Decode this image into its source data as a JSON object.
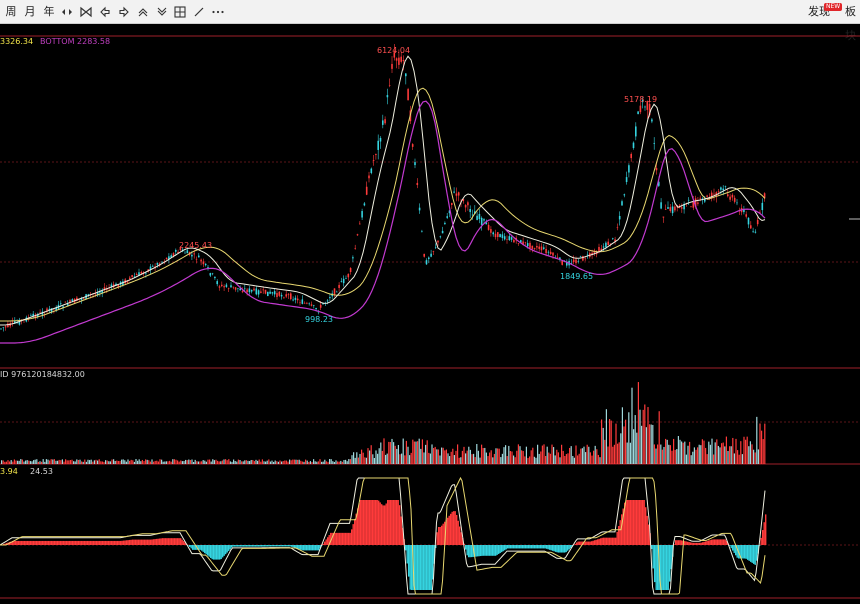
{
  "toolbar": {
    "items": [
      "周",
      "月",
      "年"
    ],
    "right_items": [
      "发现",
      "板块"
    ],
    "badge": "NEW",
    "colors": {
      "bg": "#f2f2f2",
      "text": "#222222"
    }
  },
  "main_panel": {
    "top_label": "3326.34",
    "bottom_label": "BOTTOM 2283.58",
    "annotations": {
      "high_1": "2245.43",
      "low_1": "998.23",
      "high_2": "6124.04",
      "low_2": "1849.65",
      "high_3": "5178.19"
    }
  },
  "volume_panel": {
    "label": "ID 976120184832.00"
  },
  "macd_panel": {
    "label_a": "3.94",
    "label_b": "24.53"
  },
  "colors": {
    "up": "#ff3b3b",
    "down": "#35d4e0",
    "ma_white": "#f0f0e0",
    "ma_yellow": "#e8d870",
    "ma_magenta": "#c23ad0",
    "divider": "#a0202a"
  }
}
